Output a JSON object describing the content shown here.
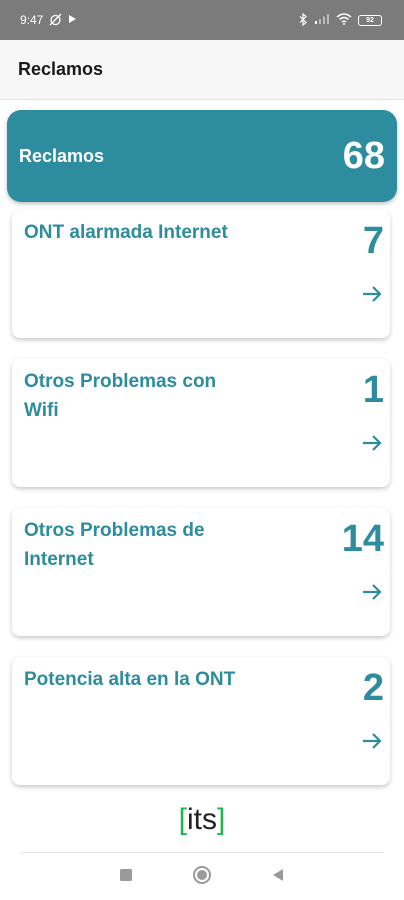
{
  "status_bar": {
    "time": "9:47",
    "battery": "92"
  },
  "app_bar": {
    "title": "Reclamos"
  },
  "summary": {
    "label": "Reclamos",
    "count": "68"
  },
  "cards": [
    {
      "title": "ONT alarmada Internet",
      "count": "7"
    },
    {
      "title": "Otros Problemas con Wifi",
      "count": "1"
    },
    {
      "title": "Otros Problemas de Internet",
      "count": "14"
    },
    {
      "title": "Potencia alta en la ONT",
      "count": "2"
    }
  ],
  "logo": {
    "text": "its"
  },
  "colors": {
    "accent": "#2d8c9e",
    "status_bar": "#7b7b7b",
    "logo_bracket": "#25b34b"
  }
}
